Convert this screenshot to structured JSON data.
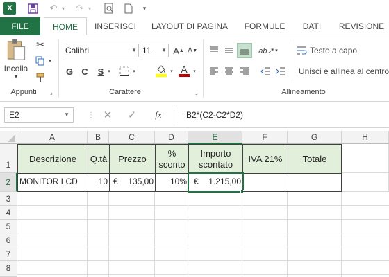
{
  "quick_access": {
    "icons": [
      "excel-logo-icon",
      "save-icon",
      "undo-icon",
      "redo-icon",
      "print-preview-icon",
      "new-document-icon",
      "customize-icon"
    ]
  },
  "tabs": [
    "FILE",
    "HOME",
    "INSERISCI",
    "LAYOUT DI PAGINA",
    "FORMULE",
    "DATI",
    "REVISIONE"
  ],
  "ribbon": {
    "clipboard": {
      "paste_label": "Incolla",
      "group_label": "Appunti"
    },
    "font": {
      "font_name": "Calibri",
      "font_size": "11",
      "group_label": "Carattere",
      "bold": "G",
      "italic": "C",
      "underline": "S",
      "font_color": "#c00000"
    },
    "alignment": {
      "wrap_text_label": "Testo a capo",
      "merge_label": "Unisci e allinea al centro",
      "group_label": "Allineamento"
    }
  },
  "formula_bar": {
    "name_box": "E2",
    "fx": "fx",
    "formula": "=B2*(C2-C2*D2)"
  },
  "sheet": {
    "columns": [
      "A",
      "B",
      "C",
      "D",
      "E",
      "F",
      "G",
      "H"
    ],
    "rows": [
      "1",
      "2",
      "3",
      "4",
      "5",
      "6",
      "7",
      "8"
    ],
    "active_column": "E",
    "active_row": "2",
    "header_fill": "#e2efda",
    "headers": {
      "A1": "Descrizione",
      "B1": "Q.tà",
      "C1": "Prezzo",
      "D1": "% sconto",
      "E1": "Importo scontato",
      "F1": "IVA 21%",
      "G1": "Totale"
    },
    "data": {
      "A2": "MONITOR LCD",
      "B2": "10",
      "C2_symbol": "€",
      "C2": "135,00",
      "D2": "10%",
      "E2_symbol": "€",
      "E2": "1.215,00",
      "F2": "",
      "G2": ""
    }
  },
  "accent_color": "#217346"
}
